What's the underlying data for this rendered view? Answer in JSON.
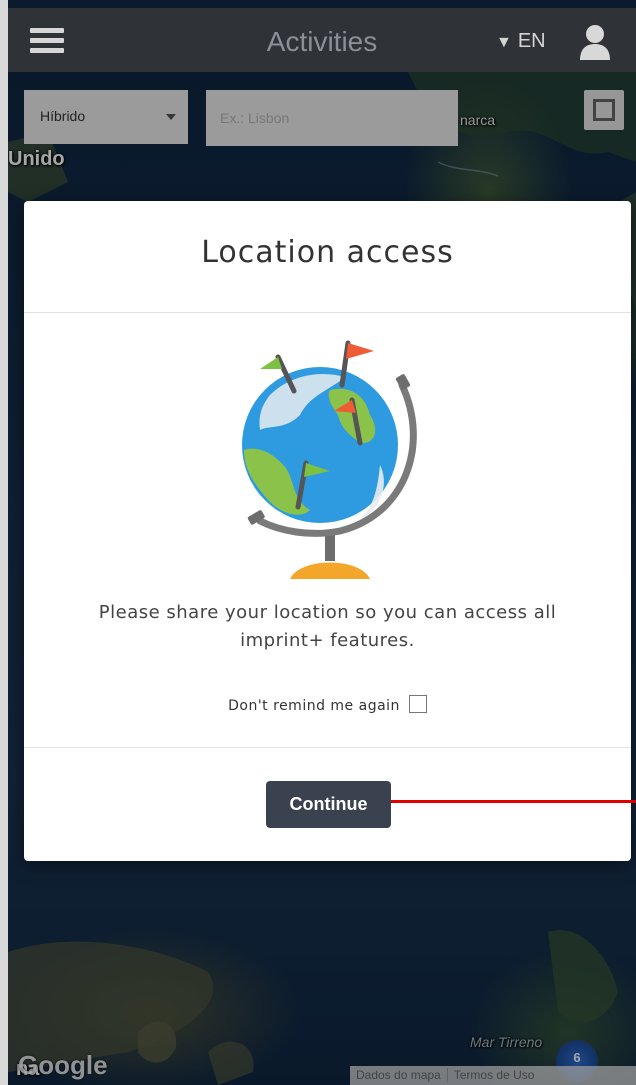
{
  "header": {
    "title": "Activities",
    "language_label": "EN",
    "menu_icon": "hamburger-menu-icon",
    "user_icon": "user-icon"
  },
  "map": {
    "map_type_selected": "Híbrido",
    "search_placeholder": "Ex.: Lisbon",
    "labels": {
      "marca": "narca",
      "unido": "Unido",
      "na": "na",
      "tirreno": "Mar Tirreno"
    },
    "google_logo": "Google",
    "cluster_count": "6",
    "attribution": {
      "map_data": "Dados do mapa",
      "terms": "Termos de Uso"
    }
  },
  "modal": {
    "title": "Location access",
    "message": "Please share your location so you can access all imprint+ features.",
    "remind_label": "Don't remind me again",
    "remind_checked": false,
    "continue_label": "Continue",
    "illustration_icon": "globe-with-flags-icon"
  },
  "colors": {
    "header_bg": "#2f3338",
    "button_bg": "#3a4250",
    "pointer_line": "#e00000",
    "globe_ocean": "#2e9ae0",
    "globe_land": "#8bc34a"
  }
}
